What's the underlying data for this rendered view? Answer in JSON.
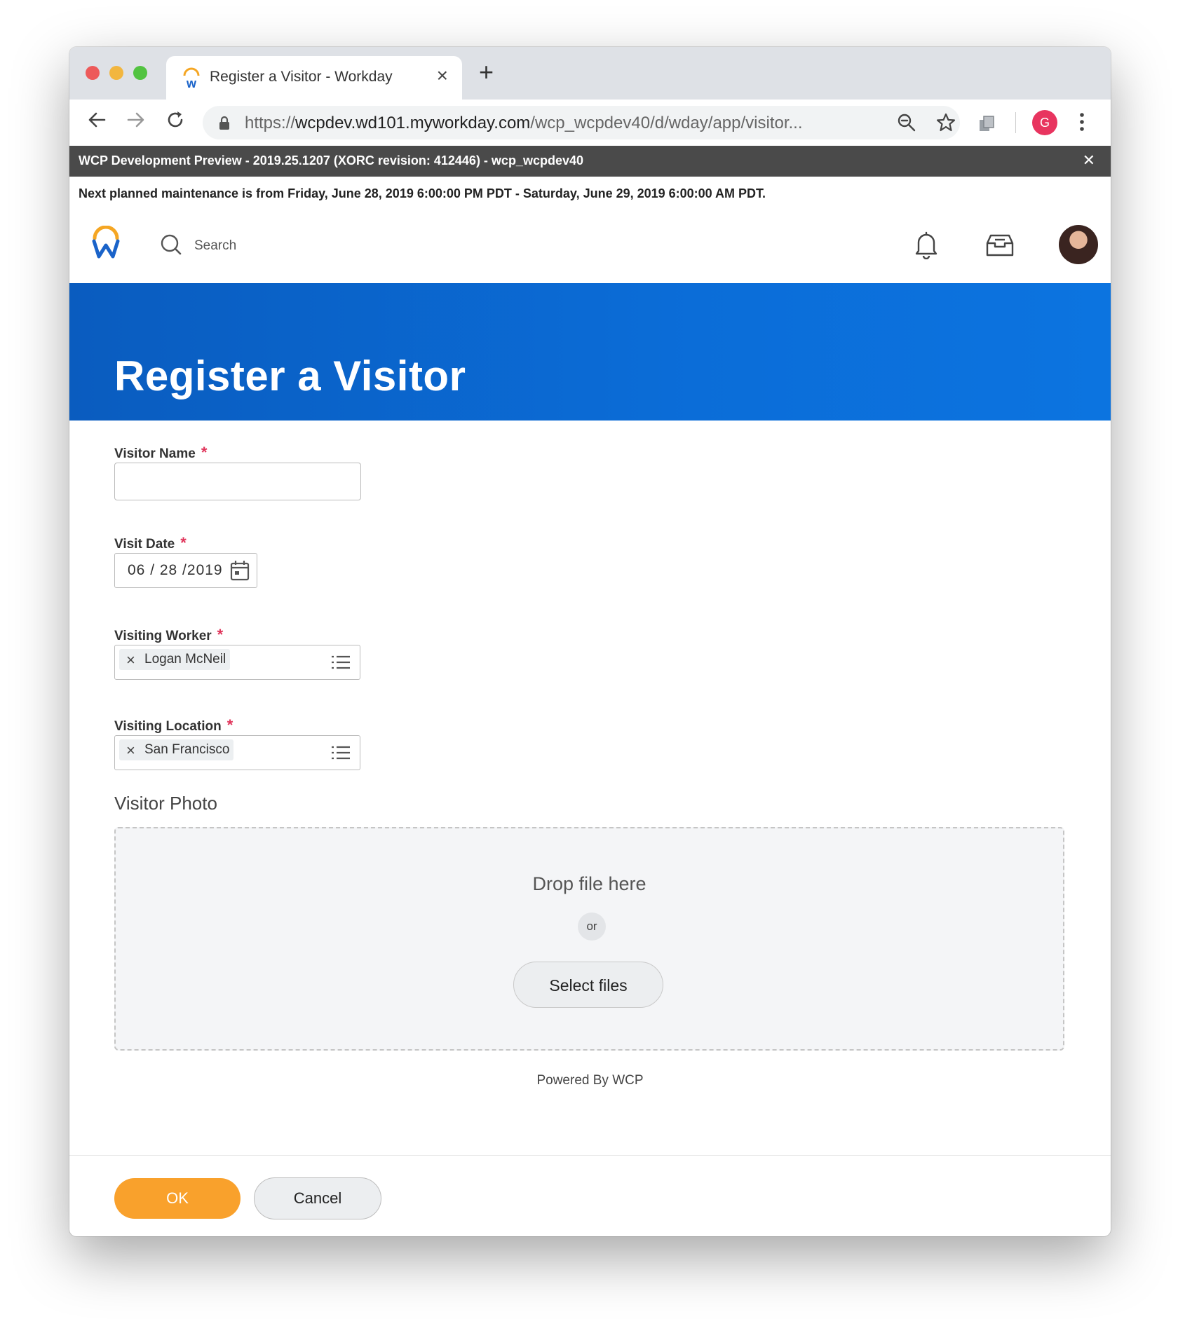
{
  "browser": {
    "tab_title": "Register a Visitor - Workday",
    "url_scheme": "https://",
    "url_host": "wcpdev.wd101.myworkday.com",
    "url_path": "/wcp_wcpdev40/d/wday/app/visitor...",
    "profile_initial": "G"
  },
  "banners": {
    "dev_text": "WCP Development Preview - 2019.25.1207 (XORC revision: 412446) - wcp_wcpdev40",
    "maintenance_text": "Next planned maintenance is from Friday, June 28, 2019 6:00:00 PM PDT - Saturday, June 29, 2019 6:00:00 AM PDT."
  },
  "header": {
    "search_label": "Search"
  },
  "page": {
    "title": "Register a Visitor"
  },
  "form": {
    "visitor_name": {
      "label": "Visitor Name",
      "required": "*",
      "value": ""
    },
    "visit_date": {
      "label": "Visit Date",
      "required": "*",
      "value": "06 / 28 /2019"
    },
    "visiting_worker": {
      "label": "Visiting Worker",
      "required": "*",
      "value": "Logan McNeil"
    },
    "visiting_location": {
      "label": "Visiting Location",
      "required": "*",
      "value": "San Francisco"
    },
    "visitor_photo": {
      "label": "Visitor Photo",
      "drop_text": "Drop file here",
      "or_text": "or",
      "select_label": "Select files"
    }
  },
  "footer": {
    "powered_by": "Powered By WCP",
    "ok_label": "OK",
    "cancel_label": "Cancel"
  },
  "colors": {
    "brand_blue": "#0b6dd8",
    "ok_orange": "#f9a12c",
    "required_red": "#e0345a"
  }
}
